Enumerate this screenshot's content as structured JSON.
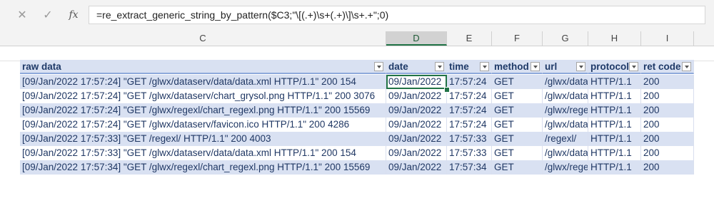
{
  "formula_bar": {
    "cancel_icon": "✕",
    "confirm_icon": "✓",
    "fx_label": "fx",
    "formula": "=re_extract_generic_string_by_pattern($C3;\"\\[(.+)\\s+(.+)\\]\\s+.+\";0)"
  },
  "columns": [
    "C",
    "D",
    "E",
    "F",
    "G",
    "H",
    "I"
  ],
  "selected_column": "D",
  "table": {
    "headers": [
      "raw data",
      "date",
      "time",
      "method",
      "url",
      "protocol",
      "ret code"
    ],
    "rows": [
      [
        "[09/Jan/2022 17:57:24] \"GET /glwx/dataserv/data/data.xml HTTP/1.1\" 200 154",
        "09/Jan/2022",
        "17:57:24",
        "GET",
        "/glwx/dataserv/data/data.xml",
        "HTTP/1.1",
        "200"
      ],
      [
        "[09/Jan/2022 17:57:24] \"GET /glwx/dataserv/chart_grysol.png HTTP/1.1\" 200 3076",
        "09/Jan/2022",
        "17:57:24",
        "GET",
        "/glwx/dataserv/chart_grysol.png",
        "HTTP/1.1",
        "200"
      ],
      [
        "[09/Jan/2022 17:57:24] \"GET /glwx/regexl/chart_regexl.png HTTP/1.1\" 200 15569",
        "09/Jan/2022",
        "17:57:24",
        "GET",
        "/glwx/regexl/chart_regexl.png",
        "HTTP/1.1",
        "200"
      ],
      [
        "[09/Jan/2022 17:57:24] \"GET /glwx/dataserv/favicon.ico HTTP/1.1\" 200 4286",
        "09/Jan/2022",
        "17:57:24",
        "GET",
        "/glwx/dataserv/favicon.ico",
        "HTTP/1.1",
        "200"
      ],
      [
        "[09/Jan/2022 17:57:33] \"GET /regexl/ HTTP/1.1\" 200 4003",
        "09/Jan/2022",
        "17:57:33",
        "GET",
        "/regexl/",
        "HTTP/1.1",
        "200"
      ],
      [
        "[09/Jan/2022 17:57:33] \"GET /glwx/dataserv/data/data.xml HTTP/1.1\" 200 154",
        "09/Jan/2022",
        "17:57:33",
        "GET",
        "/glwx/dataserv/data/data.xml",
        "HTTP/1.1",
        "200"
      ],
      [
        "[09/Jan/2022 17:57:34] \"GET /glwx/regexl/chart_regexl.png HTTP/1.1\" 200 15569",
        "09/Jan/2022",
        "17:57:34",
        "GET",
        "/glwx/regexl/chart_regexl.png",
        "HTTP/1.1",
        "200"
      ]
    ]
  },
  "colors": {
    "band": "#d9e1f2",
    "header_border": "#8ea9db",
    "selection": "#217346"
  }
}
